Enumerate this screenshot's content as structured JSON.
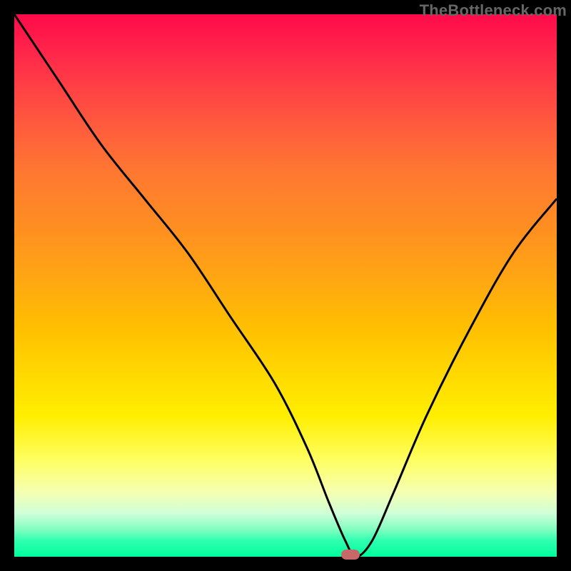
{
  "watermark": "TheBottleneck.com",
  "chart_data": {
    "type": "line",
    "title": "",
    "xlabel": "",
    "ylabel": "",
    "xlim": [
      0,
      100
    ],
    "ylim": [
      0,
      100
    ],
    "gradient_stops": [
      {
        "pos": 0,
        "color": "#ff0a4a"
      },
      {
        "pos": 50,
        "color": "#ffc000"
      },
      {
        "pos": 85,
        "color": "#ffff80"
      },
      {
        "pos": 100,
        "color": "#00ff9c"
      }
    ],
    "series": [
      {
        "name": "bottleneck-curve",
        "x": [
          0,
          8,
          16,
          24,
          32,
          40,
          48,
          54,
          58,
          61,
          63,
          66,
          70,
          76,
          84,
          92,
          100
        ],
        "y": [
          100,
          88,
          76,
          66,
          56,
          44,
          32,
          20,
          10,
          3,
          0,
          3,
          12,
          26,
          42,
          56,
          66
        ]
      }
    ],
    "min_marker": {
      "x": 62,
      "y": 0,
      "color": "#c96868"
    }
  }
}
